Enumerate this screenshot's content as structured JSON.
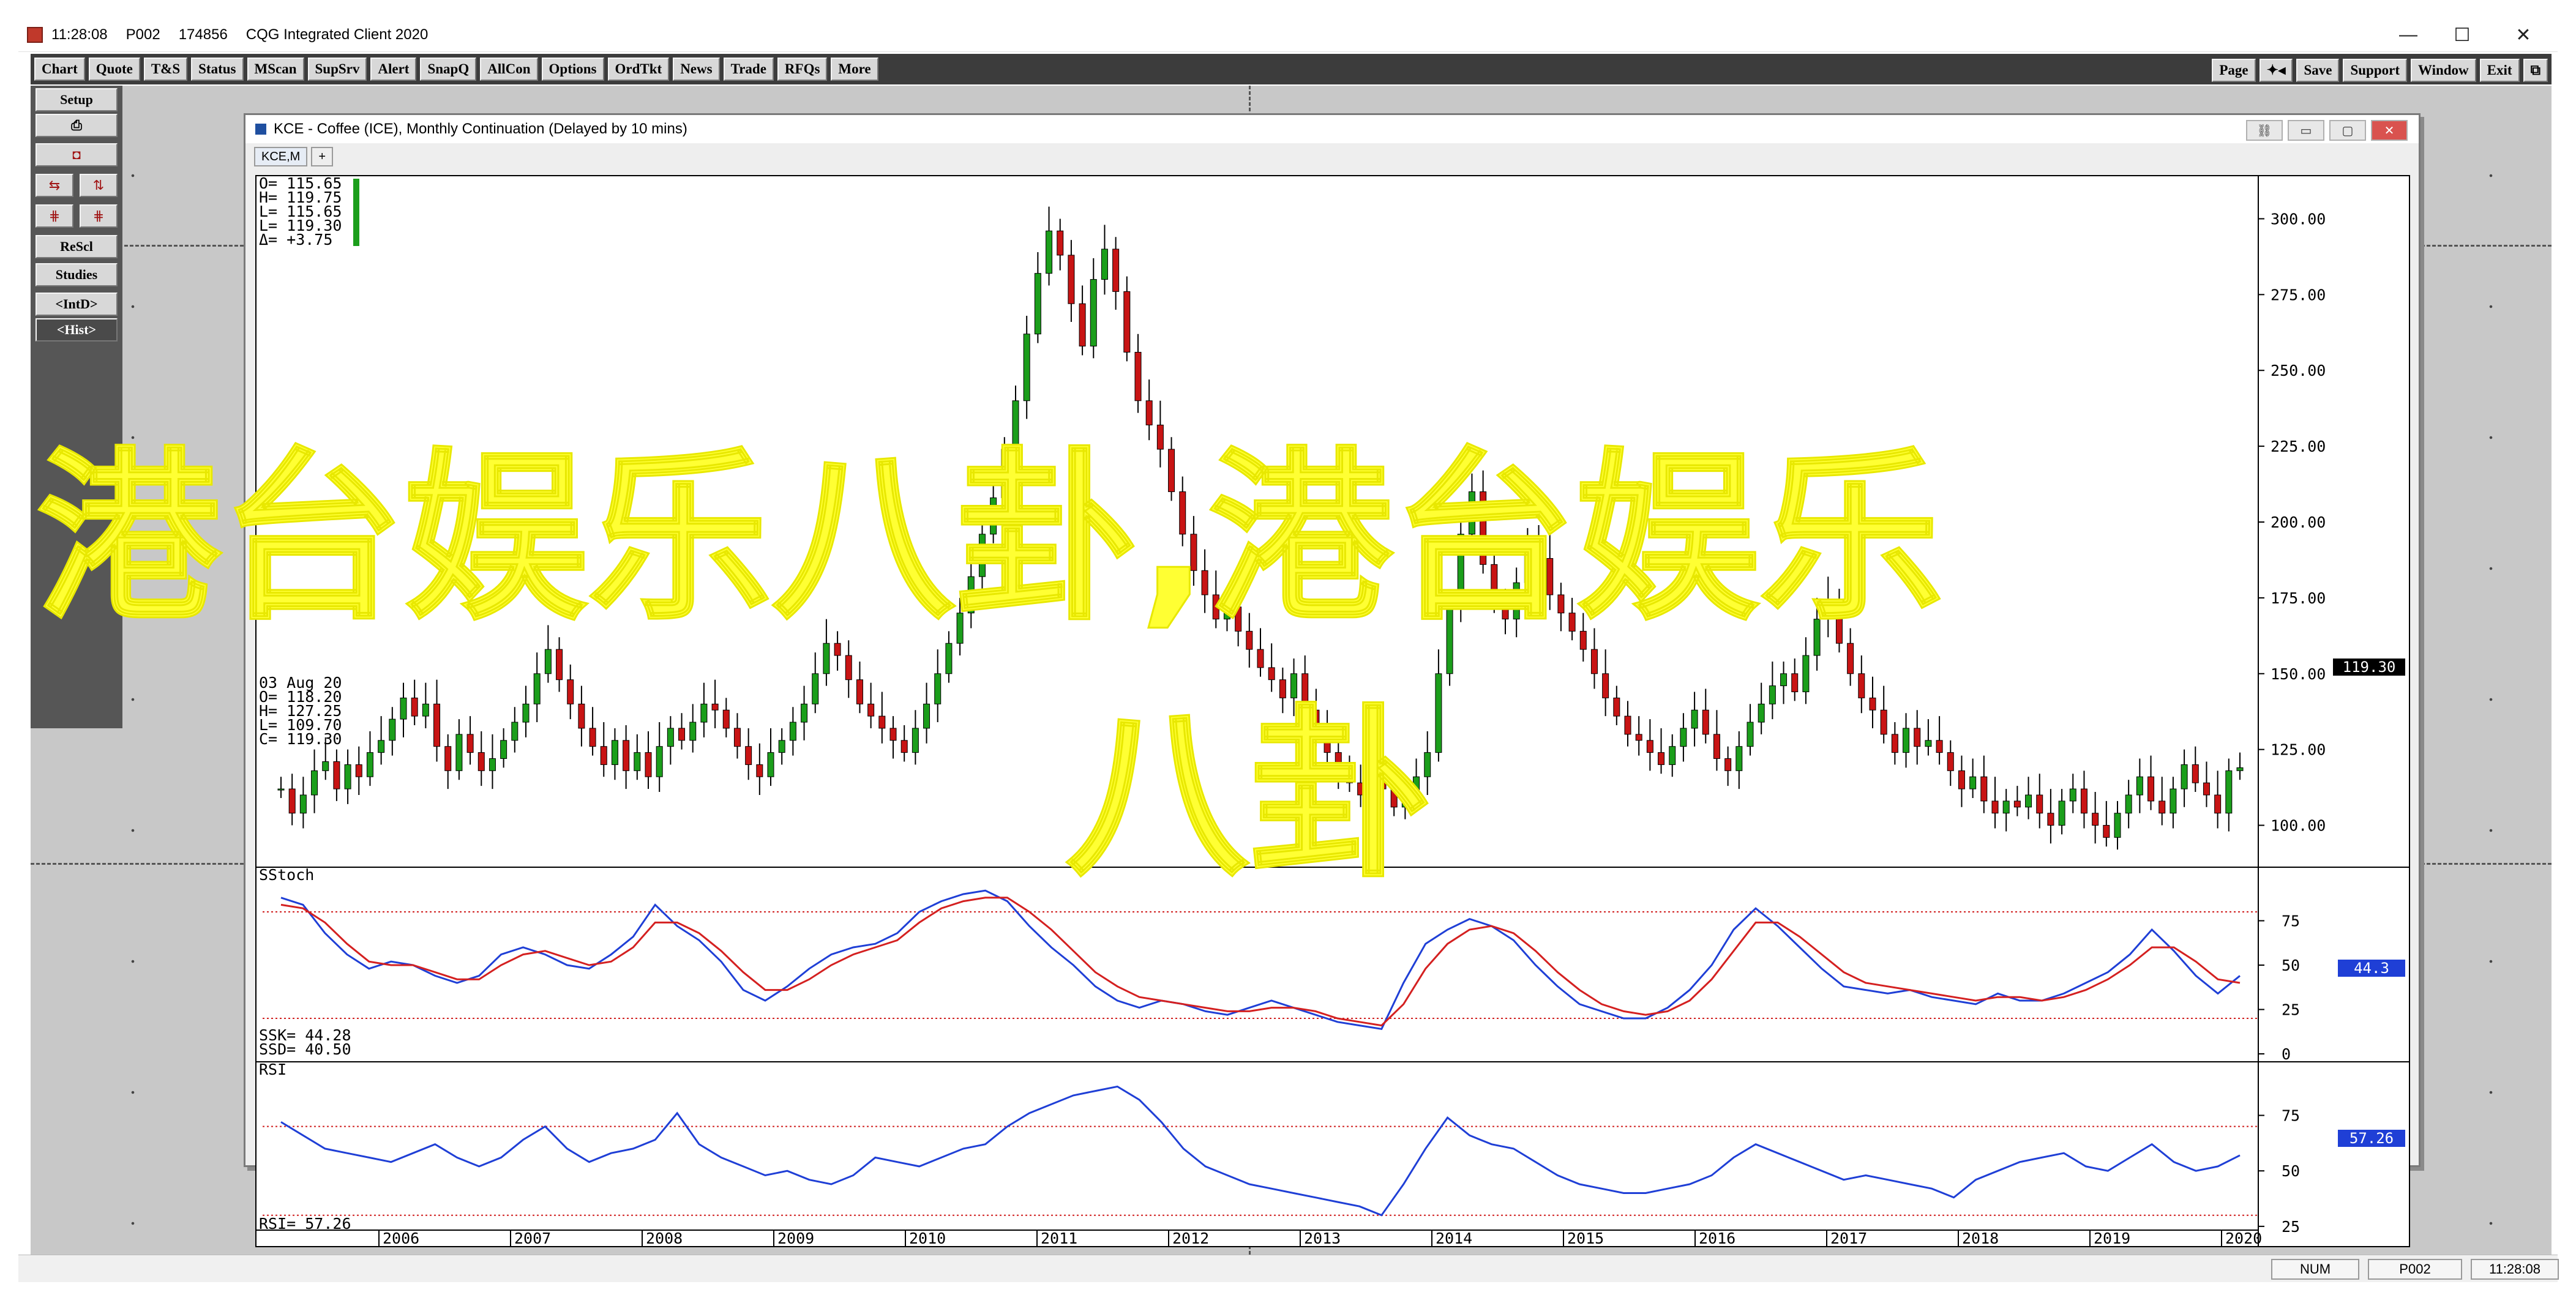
{
  "titlebar": {
    "time": "11:28:08",
    "page": "P002",
    "account": "174856",
    "app": "CQG Integrated Client 2020",
    "minimize": "—",
    "maximize": "☐",
    "close": "✕"
  },
  "toolbar": {
    "left": [
      "Chart",
      "Quote",
      "T&S",
      "Status",
      "MScan",
      "SupSrv",
      "Alert",
      "SnapQ",
      "AllCon",
      "Options",
      "OrdTkt",
      "News",
      "Trade",
      "RFQs",
      "More"
    ],
    "right": [
      "Page",
      "✦◂",
      "Save",
      "Support",
      "Window",
      "Exit",
      "⧉"
    ]
  },
  "leftpanel": {
    "setup": "Setup",
    "rescl": "ReScl",
    "studies": "Studies",
    "intd": "<IntD>",
    "hist": "<Hist>",
    "print_icon": "⎙",
    "icon2": "◘",
    "arrows1": "⇆",
    "arrows2": "⇅",
    "hash1": "⋕",
    "hash2": "⋕"
  },
  "chartwin": {
    "title": "KCE - Coffee (ICE), Monthly Continuation (Delayed by 10 mins)",
    "tab": "KCE,M",
    "tab_add": "+"
  },
  "price_info": {
    "lines": [
      "O=  115.65",
      "H=  119.75",
      "L=  115.65",
      "L=  119.30",
      "Δ=   +3.75"
    ]
  },
  "hover_info": {
    "lines": [
      "03 Aug 20",
      "O=   118.20",
      "H=   127.25",
      "L=   109.70",
      "C=   119.30"
    ]
  },
  "sstoch_info": {
    "label": "SStoch",
    "lines": [
      "SSK=   44.28",
      "SSD=   40.50"
    ],
    "last": "44.3"
  },
  "rsi_info": {
    "label": "RSI",
    "line": "RSI=   57.26",
    "last": "57.26"
  },
  "price_last": "119.30",
  "watermark": {
    "line1": "港台娱乐八卦,港台娱乐",
    "line2": "八卦"
  },
  "chart_data": [
    {
      "type": "candlestick",
      "title": "KCE - Coffee (ICE), Monthly Continuation",
      "x": [
        "2006",
        "2007",
        "2008",
        "2009",
        "2010",
        "2011",
        "2012",
        "2013",
        "2014",
        "2015",
        "2016",
        "2017",
        "2018",
        "2019",
        "2020"
      ],
      "y_ticks": [
        "300.00",
        "275.00",
        "250.00",
        "225.00",
        "200.00",
        "175.00",
        "150.00",
        "125.00",
        "100.00"
      ],
      "ylim": [
        88,
        312
      ],
      "close_series": [
        112,
        104,
        110,
        118,
        121,
        112,
        120,
        116,
        124,
        128,
        135,
        142,
        136,
        140,
        126,
        118,
        130,
        124,
        118,
        122,
        128,
        134,
        140,
        150,
        158,
        148,
        140,
        132,
        126,
        120,
        128,
        118,
        124,
        116,
        126,
        132,
        128,
        134,
        140,
        138,
        132,
        126,
        120,
        116,
        124,
        128,
        134,
        140,
        150,
        160,
        156,
        148,
        140,
        136,
        132,
        128,
        124,
        132,
        140,
        150,
        160,
        170,
        182,
        196,
        208,
        224,
        240,
        262,
        282,
        296,
        288,
        272,
        258,
        280,
        290,
        276,
        256,
        240,
        232,
        224,
        210,
        196,
        184,
        176,
        168,
        172,
        164,
        158,
        152,
        148,
        142,
        150,
        138,
        130,
        124,
        118,
        114,
        110,
        118,
        112,
        106,
        110,
        116,
        124,
        150,
        172,
        196,
        210,
        186,
        174,
        168,
        180,
        192,
        188,
        176,
        170,
        164,
        158,
        150,
        142,
        136,
        130,
        128,
        124,
        120,
        126,
        132,
        138,
        130,
        122,
        118,
        126,
        134,
        140,
        146,
        150,
        144,
        156,
        168,
        174,
        160,
        150,
        142,
        138,
        130,
        124,
        132,
        126,
        128,
        124,
        118,
        112,
        116,
        108,
        104,
        108,
        106,
        110,
        104,
        100,
        108,
        112,
        104,
        100,
        96,
        104,
        110,
        116,
        108,
        104,
        112,
        120,
        114,
        110,
        104,
        118,
        119
      ]
    },
    {
      "type": "line",
      "title": "SStoch",
      "x": [
        "2006",
        "2007",
        "2008",
        "2009",
        "2010",
        "2011",
        "2012",
        "2013",
        "2014",
        "2015",
        "2016",
        "2017",
        "2018",
        "2019",
        "2020"
      ],
      "y_ticks": [
        "75",
        "50",
        "25",
        "0"
      ],
      "ylim": [
        0,
        100
      ],
      "reference_lines": [
        80,
        20
      ],
      "series": [
        {
          "name": "SSK",
          "values": [
            88,
            84,
            68,
            56,
            48,
            52,
            50,
            44,
            40,
            44,
            56,
            60,
            56,
            50,
            48,
            56,
            66,
            84,
            72,
            64,
            52,
            36,
            30,
            38,
            48,
            56,
            60,
            62,
            68,
            80,
            86,
            90,
            92,
            86,
            72,
            60,
            50,
            38,
            30,
            26,
            30,
            28,
            24,
            22,
            26,
            30,
            26,
            22,
            18,
            16,
            14,
            40,
            62,
            70,
            76,
            72,
            64,
            50,
            38,
            28,
            24,
            20,
            20,
            26,
            36,
            50,
            70,
            82,
            72,
            60,
            48,
            38,
            36,
            34,
            36,
            32,
            30,
            28,
            34,
            30,
            30,
            34,
            40,
            46,
            56,
            70,
            58,
            44,
            34,
            44
          ]
        },
        {
          "name": "SSD",
          "values": [
            84,
            82,
            74,
            62,
            52,
            50,
            50,
            46,
            42,
            42,
            50,
            56,
            58,
            54,
            50,
            52,
            60,
            74,
            74,
            68,
            58,
            46,
            36,
            36,
            42,
            50,
            56,
            60,
            64,
            74,
            82,
            86,
            88,
            88,
            80,
            70,
            58,
            46,
            38,
            32,
            30,
            28,
            26,
            24,
            24,
            26,
            26,
            24,
            20,
            18,
            16,
            28,
            48,
            62,
            70,
            72,
            68,
            58,
            46,
            36,
            28,
            24,
            22,
            24,
            30,
            42,
            58,
            74,
            74,
            66,
            56,
            46,
            40,
            38,
            36,
            34,
            32,
            30,
            32,
            32,
            30,
            32,
            36,
            42,
            50,
            60,
            60,
            52,
            42,
            40
          ]
        }
      ]
    },
    {
      "type": "line",
      "title": "RSI",
      "x": [
        "2006",
        "2007",
        "2008",
        "2009",
        "2010",
        "2011",
        "2012",
        "2013",
        "2014",
        "2015",
        "2016",
        "2017",
        "2018",
        "2019",
        "2020"
      ],
      "y_ticks": [
        "75",
        "50",
        "25"
      ],
      "ylim": [
        20,
        95
      ],
      "reference_lines": [
        70,
        30
      ],
      "series": [
        {
          "name": "RSI",
          "values": [
            72,
            66,
            60,
            58,
            56,
            54,
            58,
            62,
            56,
            52,
            56,
            64,
            70,
            60,
            54,
            58,
            60,
            64,
            76,
            62,
            56,
            52,
            48,
            50,
            46,
            44,
            48,
            56,
            54,
            52,
            56,
            60,
            62,
            70,
            76,
            80,
            84,
            86,
            88,
            82,
            72,
            60,
            52,
            48,
            44,
            42,
            40,
            38,
            36,
            34,
            30,
            44,
            60,
            74,
            66,
            62,
            60,
            54,
            48,
            44,
            42,
            40,
            40,
            42,
            44,
            48,
            56,
            62,
            58,
            54,
            50,
            46,
            48,
            46,
            44,
            42,
            38,
            46,
            50,
            54,
            56,
            58,
            52,
            50,
            56,
            62,
            54,
            50,
            52,
            57
          ]
        }
      ]
    }
  ],
  "statusbar": {
    "num": "NUM",
    "page": "P002",
    "time": "11:28:08"
  }
}
